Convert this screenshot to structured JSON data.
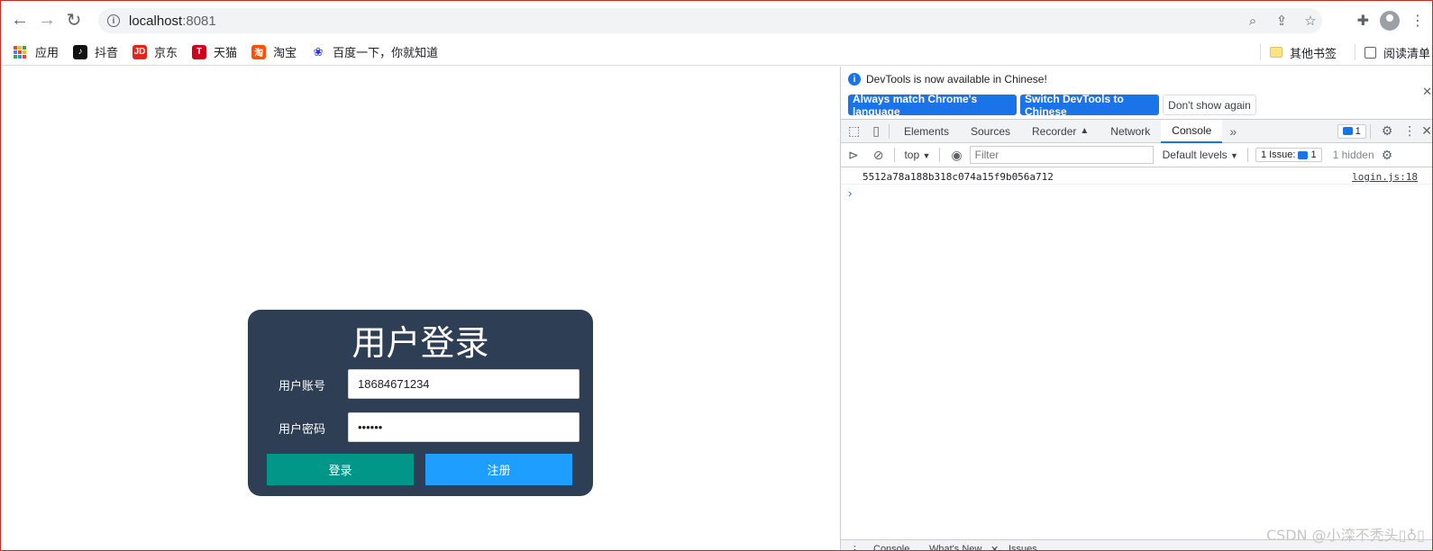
{
  "browser": {
    "url_host": "localhost",
    "url_port": ":8081"
  },
  "bookmarks": {
    "apps": "应用",
    "items": [
      {
        "label": "抖音",
        "icon": "douyin-icon",
        "color": "#111111"
      },
      {
        "label": "京东",
        "icon": "jd-icon",
        "color": "#e1251b"
      },
      {
        "label": "天猫",
        "icon": "tmall-icon",
        "color": "#d0021b"
      },
      {
        "label": "淘宝",
        "icon": "taobao-icon",
        "color": "#ff5000"
      },
      {
        "label": "百度一下，你就知道",
        "icon": "baidu-icon",
        "color": "#2932e1"
      }
    ],
    "other": "其他书签",
    "reading_list": "阅读清单"
  },
  "login": {
    "title": "用户登录",
    "account_label": "用户账号",
    "account_value": "18684671234",
    "password_label": "用户密码",
    "password_value": "••••••",
    "login_button": "登录",
    "register_button": "注册",
    "card_color": "#2e3e54",
    "login_color": "#009688",
    "register_color": "#1e9fff"
  },
  "devtools": {
    "info_message": "DevTools is now available in Chinese!",
    "btn_match": "Always match Chrome's language",
    "btn_switch": "Switch DevTools to Chinese",
    "btn_dismiss": "Don't show again",
    "tabs": [
      "Elements",
      "Sources",
      "Recorder",
      "Network",
      "Console"
    ],
    "more": "»",
    "issues_badge": "1",
    "context": "top",
    "filter_placeholder": "Filter",
    "levels": "Default levels",
    "issues_count": "1 Issue:",
    "issues_num": "1",
    "hidden": "1 hidden",
    "log_message": "5512a78a188b318c074a15f9b056a712",
    "log_source": "login.js:18",
    "drawer_tabs": [
      "Console",
      "What's New",
      "Issues"
    ]
  },
  "watermark": "CSDN @小滦不秃头▯♁▯"
}
